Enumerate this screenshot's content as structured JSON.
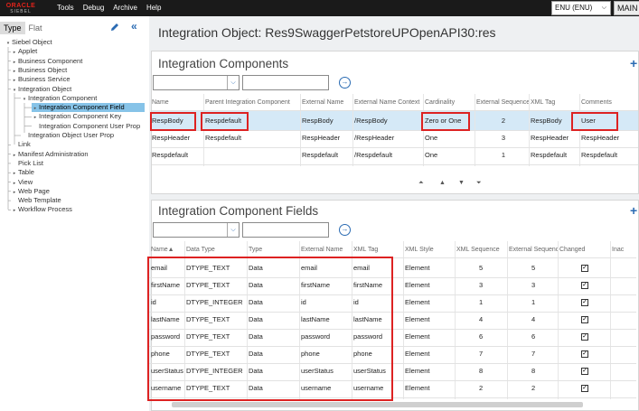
{
  "topbar": {
    "logo_oracle": "ORACLE",
    "logo_siebel": "SIEBEL",
    "menu": [
      "Tools",
      "Debug",
      "Archive",
      "Help"
    ],
    "locale_value": "ENU (ENU)",
    "main_label": "MAIN"
  },
  "left": {
    "tabs": [
      "Type",
      "Flat"
    ],
    "tree": [
      {
        "label": "Siebel Object",
        "indent": 0,
        "toggle": "▾"
      },
      {
        "label": "Applet",
        "indent": 1,
        "toggle": "▸"
      },
      {
        "label": "Business Component",
        "indent": 1,
        "toggle": "▸"
      },
      {
        "label": "Business Object",
        "indent": 1,
        "toggle": "▸"
      },
      {
        "label": "Business Service",
        "indent": 1,
        "toggle": "▸"
      },
      {
        "label": "Integration Object",
        "indent": 1,
        "toggle": "▾"
      },
      {
        "label": "Integration Component",
        "indent": 2,
        "toggle": "▾"
      },
      {
        "label": "Integration Component Field",
        "indent": 3,
        "toggle": "▸",
        "selected": true
      },
      {
        "label": "Integration Component Key",
        "indent": 3,
        "toggle": "▸"
      },
      {
        "label": "Integration Component User Prop",
        "indent": 3,
        "toggle": ""
      },
      {
        "label": "Integration Object User Prop",
        "indent": 2,
        "toggle": ""
      },
      {
        "label": "Link",
        "indent": 1,
        "toggle": ""
      },
      {
        "label": "Manifest Administration",
        "indent": 1,
        "toggle": "▸"
      },
      {
        "label": "Pick List",
        "indent": 1,
        "toggle": ""
      },
      {
        "label": "Table",
        "indent": 1,
        "toggle": "▸"
      },
      {
        "label": "View",
        "indent": 1,
        "toggle": "▸"
      },
      {
        "label": "Web Page",
        "indent": 1,
        "toggle": "▸"
      },
      {
        "label": "Web Template",
        "indent": 1,
        "toggle": ""
      },
      {
        "label": "Workflow Process",
        "indent": 1,
        "toggle": "▸"
      }
    ]
  },
  "page_title": "Integration Object: Res9SwaggerPetstoreUPOpenAPI30:res",
  "components": {
    "title": "Integration Components",
    "headers": [
      "Name",
      "Parent Integration Component",
      "External Name",
      "External Name Context",
      "Cardinality",
      "External Sequence",
      "XML Tag",
      "Comments"
    ],
    "rows": [
      [
        "RespBody",
        "Respdefault",
        "RespBody",
        "/RespBody",
        "Zero or One",
        "2",
        "RespBody",
        "User"
      ],
      [
        "RespHeader",
        "Respdefault",
        "RespHeader",
        "/RespHeader",
        "One",
        "3",
        "RespHeader",
        "RespHeader"
      ],
      [
        "Respdefault",
        "",
        "Respdefault",
        "/Respdefault",
        "One",
        "1",
        "Respdefault",
        "Respdefault"
      ]
    ],
    "pager": [
      "⏶",
      "▲",
      "▼",
      "⏷"
    ]
  },
  "fields": {
    "title": "Integration Component Fields",
    "headers": [
      "Name▲",
      "Data Type",
      "Type",
      "External Name",
      "XML Tag",
      "XML Style",
      "XML Sequence",
      "External Sequence",
      "Changed",
      "Inac"
    ],
    "rows": [
      [
        "email",
        "DTYPE_TEXT",
        "Data",
        "email",
        "email",
        "Element",
        "5",
        "5"
      ],
      [
        "firstName",
        "DTYPE_TEXT",
        "Data",
        "firstName",
        "firstName",
        "Element",
        "3",
        "3"
      ],
      [
        "id",
        "DTYPE_INTEGER",
        "Data",
        "id",
        "id",
        "Element",
        "1",
        "1"
      ],
      [
        "lastName",
        "DTYPE_TEXT",
        "Data",
        "lastName",
        "lastName",
        "Element",
        "4",
        "4"
      ],
      [
        "password",
        "DTYPE_TEXT",
        "Data",
        "password",
        "password",
        "Element",
        "6",
        "6"
      ],
      [
        "phone",
        "DTYPE_TEXT",
        "Data",
        "phone",
        "phone",
        "Element",
        "7",
        "7"
      ],
      [
        "userStatus",
        "DTYPE_INTEGER",
        "Data",
        "userStatus",
        "userStatus",
        "Element",
        "8",
        "8"
      ],
      [
        "username",
        "DTYPE_TEXT",
        "Data",
        "username",
        "username",
        "Element",
        "2",
        "2"
      ]
    ],
    "changed_mark": "✓"
  },
  "icons": {
    "pencil": "pencil-icon",
    "collapse": "double-chevron-left-icon",
    "go": "arrow-right-circle-icon",
    "plus": "plus-icon"
  },
  "colors": {
    "accent": "#2a6bb3",
    "highlight": "#d22222",
    "selected_row": "#d5e9f7",
    "tree_selected": "#86c3e8"
  }
}
